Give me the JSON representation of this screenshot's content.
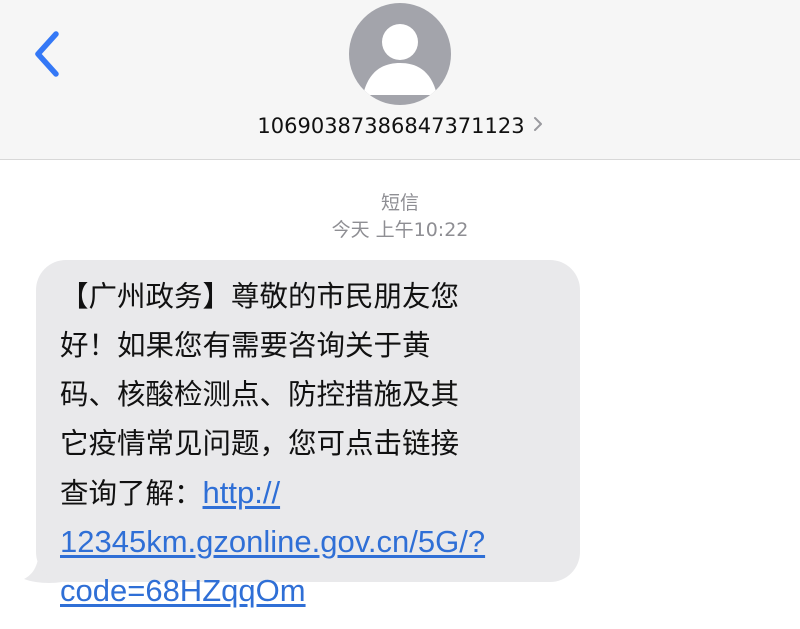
{
  "header": {
    "back_icon": "chevron-left-icon",
    "avatar_icon": "person-silhouette-icon",
    "contact_number": "10690387386847371123",
    "contact_chevron_icon": "chevron-right-icon",
    "background_color": "#f6f6f6"
  },
  "thread": {
    "service_label": "短信",
    "timestamp": "今天 上午10:22"
  },
  "message": {
    "direction": "incoming",
    "bubble_color": "#e9e9eb",
    "link_color": "#2f6fd6",
    "lines": [
      "【广州政务】尊敬的市民朋友您",
      "好！如果您有需要咨询关于黄",
      "码、核酸检测点、防控措施及其",
      "它疫情常见问题，您可点击链接"
    ],
    "link_prefix": "查询了解：",
    "link_parts": [
      "http://",
      "12345km.gzonline.gov.cn/5G/?",
      "code=68HZqqOm"
    ]
  }
}
